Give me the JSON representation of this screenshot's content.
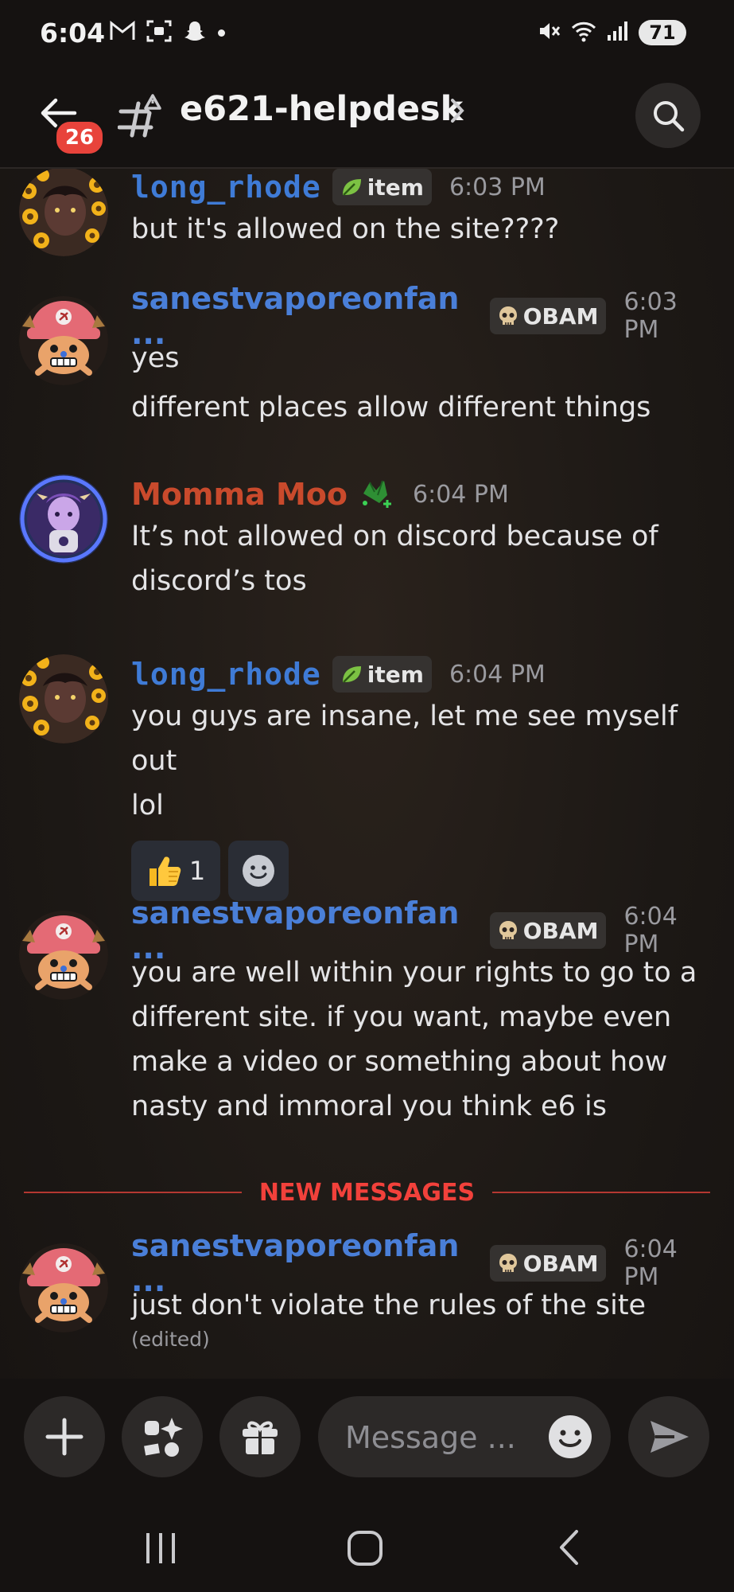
{
  "status_bar": {
    "time": "6:04",
    "battery": "71"
  },
  "header": {
    "badge_count": "26",
    "channel_name": "e621-helpdesk"
  },
  "messages": [
    {
      "username": "long_rhode",
      "username_color": "#3f7bd6",
      "tag": "item",
      "timestamp": "6:03 PM",
      "lines": [
        "but it's allowed on the site????"
      ]
    },
    {
      "username": "sanestvaporeonfan ...",
      "username_color": "#4a7fd8",
      "tag": "OBAM",
      "timestamp": "6:03 PM",
      "lines": [
        "yes",
        "different places allow different things"
      ]
    },
    {
      "username": "Momma Moo",
      "username_color": "#c94a2c",
      "timestamp": "6:04 PM",
      "lines": [
        "It’s not allowed on discord because of",
        "discord’s tos"
      ]
    },
    {
      "username": "long_rhode",
      "username_color": "#3f7bd6",
      "tag": "item",
      "timestamp": "6:04 PM",
      "lines": [
        "you guys are insane, let me see myself out",
        "lol"
      ],
      "reactions": [
        {
          "emoji": "thumbs-up",
          "count": "1"
        }
      ]
    },
    {
      "username": "sanestvaporeonfan ...",
      "username_color": "#4a7fd8",
      "tag": "OBAM",
      "timestamp": "6:04 PM",
      "lines": [
        "you are well within your rights to go to a",
        "different site. if you want, maybe even",
        "make a video or something about how",
        "nasty and immoral you think e6 is"
      ]
    },
    {
      "username": "sanestvaporeonfan ...",
      "username_color": "#4a7fd8",
      "tag": "OBAM",
      "timestamp": "6:04 PM",
      "lines": [
        "just don't violate the rules of the site"
      ],
      "edited": "(edited)"
    }
  ],
  "divider": {
    "label": "NEW MESSAGES"
  },
  "composer": {
    "placeholder": "Message ..."
  },
  "colors": {
    "accent_red": "#e8433b",
    "background": "#1e1916",
    "bar": "#151211"
  }
}
